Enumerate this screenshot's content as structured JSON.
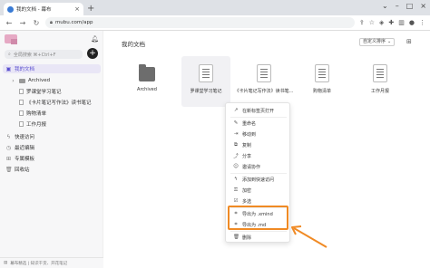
{
  "browser": {
    "tab_title": "我的文档 - 幕布",
    "url": "mubu.com/app"
  },
  "sidebar": {
    "search_placeholder": "全局搜索 ⌘+Ctrl+F",
    "items": [
      {
        "label": "我的文档"
      },
      {
        "label": "Archived"
      },
      {
        "label": "罗课堂学习笔记"
      },
      {
        "label": "《卡片笔记写作法》读书笔记"
      },
      {
        "label": "购物清单"
      },
      {
        "label": "工作月报"
      },
      {
        "label": "快速访问"
      },
      {
        "label": "最近编辑"
      },
      {
        "label": "专属模板"
      },
      {
        "label": "回收站"
      }
    ],
    "footer": "幕布精选 | 知识干货、开花笔记"
  },
  "main": {
    "title": "我的文档",
    "sort_label": "自定义排序",
    "cards": [
      {
        "label": "Archived"
      },
      {
        "label": "罗课堂学习笔记"
      },
      {
        "label": "《卡片笔记写作法》读书笔..."
      },
      {
        "label": "购物清单"
      },
      {
        "label": "工作月报"
      }
    ]
  },
  "context_menu": {
    "items": [
      {
        "label": "在新标签页打开"
      },
      {
        "label": "重命名"
      },
      {
        "label": "移动到"
      },
      {
        "label": "复制"
      },
      {
        "label": "分享"
      },
      {
        "label": "邀请协作"
      },
      {
        "label": "添加到快速访问"
      },
      {
        "label": "加密"
      },
      {
        "label": "多选"
      },
      {
        "label": "导出为 .xmind"
      },
      {
        "label": "导出为 .md"
      },
      {
        "label": "删除"
      }
    ]
  },
  "colors": {
    "accent": "#5a4fcf",
    "highlight": "#f08a24"
  }
}
